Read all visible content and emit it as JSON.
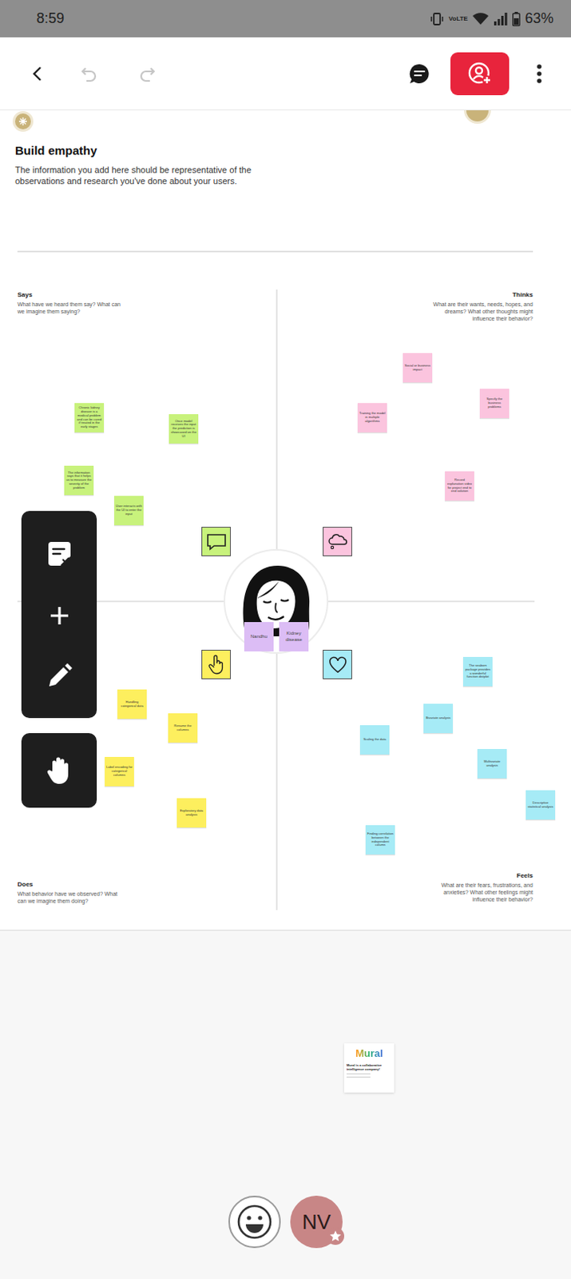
{
  "status_bar": {
    "time": "8:59",
    "network": "VoLTE",
    "battery": "63%",
    "battery_level": 0.63
  },
  "toolbar": {
    "undo": {
      "disabled": true
    },
    "redo": {
      "disabled": true
    }
  },
  "board": {
    "title": "Build empathy",
    "description": "The information you add here should be representative of the observations and research you've done about your users."
  },
  "quadrants": [
    {
      "title": "Says",
      "prompt": "What have we heard them say? What can we imagine them saying?",
      "color": "#c8f27c",
      "notes": [
        "Chronic kidney disease is a medical problem and can be cured if treated in the early stages",
        "Once model receives the input the prediction is showcased on the UI",
        "The information says that it helps us to measure the severity of the problem",
        "User interacts with the UI to enter the input"
      ]
    },
    {
      "title": "Thinks",
      "prompt": "What are their wants, needs, hopes, and dreams? What other thoughts might influence their behavior?",
      "color": "#fbc4de",
      "notes": [
        "Social or business impact",
        "Specify the business problems",
        "Training the model in multiple algorithms",
        "Record explanation video for project end to end solution"
      ]
    },
    {
      "title": "Does",
      "prompt": "What behavior have we observed? What can we imagine them doing?",
      "color": "#fdef5e",
      "notes": [
        "Handling categorical data",
        "Rename the columns",
        "Label encoding for categorical columns",
        "Exploratory data analysis"
      ]
    },
    {
      "title": "Feels",
      "prompt": "What are their fears, frustrations, and anxieties? What other feelings might influence their behavior?",
      "color": "#a6ebf6",
      "notes": [
        "The seaborn package provides a wonderful function distplot",
        "Bivariate analysis",
        "Scaling the data",
        "Multivariate analysis",
        "Descriptive statistical analysis",
        "Finding correlation between the independent column"
      ]
    }
  ],
  "persona": {
    "notes": [
      "Nandhu",
      "Kidney disease"
    ]
  },
  "card": {
    "logo": "Mural",
    "text": "Mural is a collaborative intelligence company!"
  },
  "participant": {
    "initials": "NV",
    "host": true
  }
}
